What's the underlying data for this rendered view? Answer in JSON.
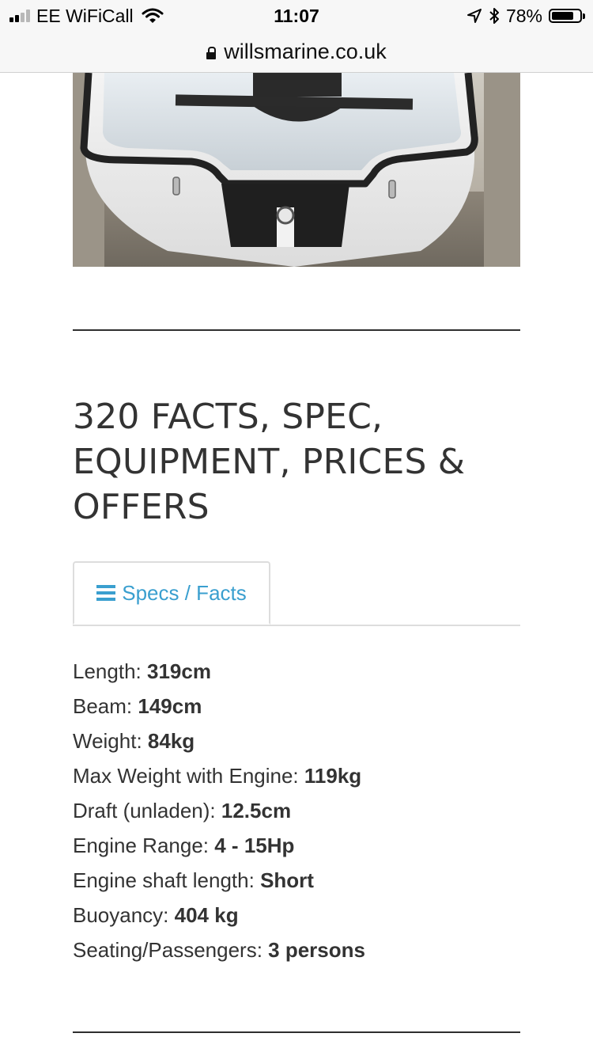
{
  "status_bar": {
    "carrier": "EE WiFiCall",
    "time": "11:07",
    "battery_percent": "78%",
    "battery_level": 0.78,
    "icons": [
      "signal-icon",
      "wifi-icon",
      "location-arrow-icon",
      "bluetooth-icon",
      "battery-icon"
    ]
  },
  "browser": {
    "url": "willsmarine.co.uk"
  },
  "content": {
    "heading": "320 FACTS, SPEC, EQUIPMENT, PRICES & OFFERS",
    "tab": {
      "label": "Specs / Facts",
      "icon": "menu-icon"
    },
    "specs": [
      {
        "label": "Length: ",
        "value": "319cm"
      },
      {
        "label": "Beam: ",
        "value": "149cm"
      },
      {
        "label": "Weight: ",
        "value": "84kg"
      },
      {
        "label": "Max Weight with Engine: ",
        "value": "119kg"
      },
      {
        "label": "Draft (unladen): ",
        "value": "12.5cm"
      },
      {
        "label": "Engine Range: ",
        "value": "4 - 15Hp"
      },
      {
        "label": "Engine shaft length: ",
        "value": "Short"
      },
      {
        "label": "Buoyancy: ",
        "value": "404 kg"
      },
      {
        "label": "Seating/Passengers: ",
        "value": "3 persons"
      }
    ]
  },
  "colors": {
    "accent": "#3a9fcf",
    "text": "#333333",
    "rule": "#2f2f2f",
    "tab_border": "#dddddd"
  }
}
